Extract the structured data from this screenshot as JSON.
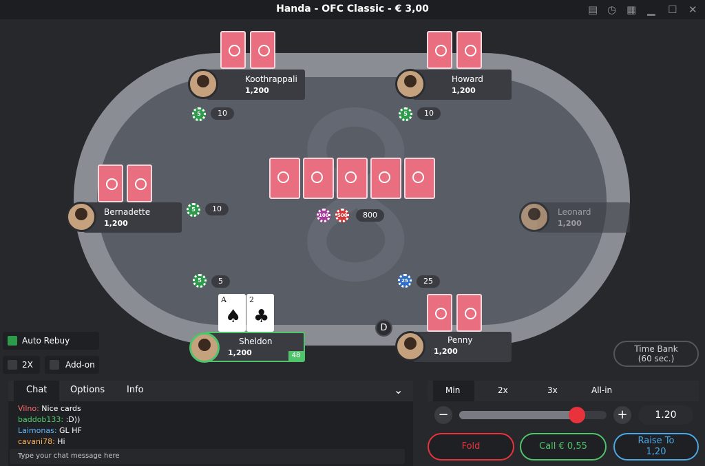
{
  "window": {
    "title": "Handa - OFC Classic - € 3,00"
  },
  "players": [
    {
      "name": "Koothrappali",
      "stack": "1,200",
      "bet": "10",
      "chip_label": "5"
    },
    {
      "name": "Howard",
      "stack": "1,200",
      "bet": "10",
      "chip_label": "5"
    },
    {
      "name": "Bernadette",
      "stack": "1,200",
      "bet": "10",
      "chip_label": "5"
    },
    {
      "name": "Leonard",
      "stack": "1,200"
    },
    {
      "name": "Sheldon",
      "stack": "1,200",
      "bet": "5",
      "chip_label": "5",
      "timer": "48",
      "cards": [
        {
          "rank": "A",
          "suit": "♠"
        },
        {
          "rank": "2",
          "suit": "♣"
        }
      ]
    },
    {
      "name": "Penny",
      "stack": "1,200",
      "bet": "25",
      "chip_label": "25"
    }
  ],
  "pot": {
    "amount": "800",
    "chip_labels": [
      "100",
      "500"
    ]
  },
  "dealer_label": "D",
  "time_bank": {
    "line1": "Time Bank",
    "line2": "(60 sec.)"
  },
  "options": {
    "auto_rebuy": "Auto Rebuy",
    "two_x": "2X",
    "add_on": "Add-on",
    "auto_rebuy_checked": true
  },
  "chat": {
    "tabs": [
      "Chat",
      "Options",
      "Info"
    ],
    "messages": [
      {
        "user": "Vilno:",
        "text": " Nice cards",
        "color": "#ff6b6b"
      },
      {
        "user": "baddob133:",
        "text": " :D))",
        "color": "#4fd16b"
      },
      {
        "user": "Laimonas:",
        "text": " GL HF",
        "color": "#5fb8ff"
      },
      {
        "user": "cavani78:",
        "text": " Hi",
        "color": "#ffb14f"
      }
    ],
    "input_placeholder": "Type your chat message here"
  },
  "bet_controls": {
    "presets": [
      "Min",
      "2x",
      "3x",
      "All-in"
    ],
    "value": "1.20",
    "slider_fraction": 0.8
  },
  "actions": {
    "fold": "Fold",
    "call": "Call € 0,55",
    "raise_line1": "Raise To",
    "raise_line2": "1,20"
  },
  "colors": {
    "fold": "#e8333d",
    "call": "#4fc46b",
    "raise": "#4aa9e6",
    "accent": "#e8333d"
  }
}
